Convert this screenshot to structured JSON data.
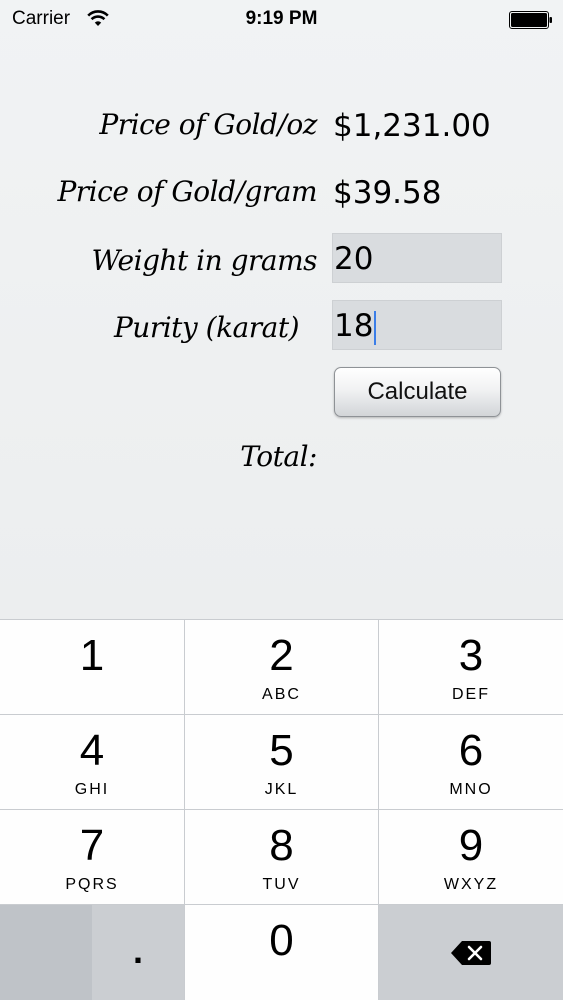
{
  "status_bar": {
    "carrier": "Carrier",
    "time": "9:19 PM",
    "icons": [
      "wifi-icon",
      "battery-icon"
    ]
  },
  "form": {
    "price_oz": {
      "label": "Price of Gold/oz",
      "value": "$1,231.00"
    },
    "price_gram": {
      "label": "Price of Gold/gram",
      "value": "$39.58"
    },
    "weight": {
      "label": "Weight in grams",
      "value": "20"
    },
    "purity": {
      "label": "Purity (karat)",
      "value": "18"
    },
    "calculate_label": "Calculate",
    "total_label": "Total:"
  },
  "keypad": {
    "keys": [
      {
        "digit": "1",
        "letters": ""
      },
      {
        "digit": "2",
        "letters": "ABC"
      },
      {
        "digit": "3",
        "letters": "DEF"
      },
      {
        "digit": "4",
        "letters": "GHI"
      },
      {
        "digit": "5",
        "letters": "JKL"
      },
      {
        "digit": "6",
        "letters": "MNO"
      },
      {
        "digit": "7",
        "letters": "PQRS"
      },
      {
        "digit": "8",
        "letters": "TUV"
      },
      {
        "digit": "9",
        "letters": "WXYZ"
      },
      {
        "digit": "0",
        "letters": ""
      }
    ],
    "decimal": ".",
    "delete_icon": "delete-backspace-icon"
  },
  "colors": {
    "background": "#eef0f1",
    "field_bg": "#d9dcdf",
    "cursor": "#3b7ee8",
    "keypad_bg": "#c9ccd0",
    "key_bg": "#fefefe",
    "key_dark": "#cbced2"
  }
}
